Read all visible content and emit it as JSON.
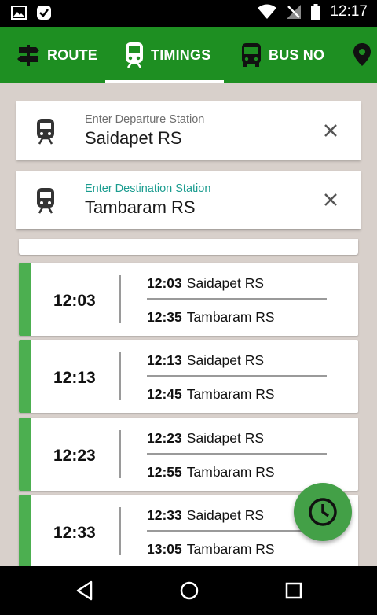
{
  "status_bar": {
    "time": "12:17"
  },
  "tabs": [
    {
      "label": "ROUTE",
      "icon": "signpost-icon"
    },
    {
      "label": "TIMINGS",
      "icon": "train-icon",
      "selected": true
    },
    {
      "label": "BUS NO",
      "icon": "bus-icon"
    },
    {
      "label": "",
      "icon": "location-pin-icon"
    }
  ],
  "departure": {
    "hint": "Enter Departure Station",
    "value": "Saidapet RS"
  },
  "destination": {
    "hint": "Enter Destination Station",
    "value": "Tambaram RS"
  },
  "trips": [
    {
      "time": "12:03",
      "from_time": "12:03",
      "from": "Saidapet RS",
      "to_time": "12:35",
      "to": "Tambaram RS"
    },
    {
      "time": "12:13",
      "from_time": "12:13",
      "from": "Saidapet RS",
      "to_time": "12:45",
      "to": "Tambaram RS"
    },
    {
      "time": "12:23",
      "from_time": "12:23",
      "from": "Saidapet RS",
      "to_time": "12:55",
      "to": "Tambaram RS"
    },
    {
      "time": "12:33",
      "from_time": "12:33",
      "from": "Saidapet RS",
      "to_time": "13:05",
      "to": "Tambaram RS"
    }
  ],
  "colors": {
    "primary": "#1e8f22",
    "accent_bar": "#4caf50",
    "fab": "#43a047",
    "hint_teal": "#1a9c8f"
  }
}
